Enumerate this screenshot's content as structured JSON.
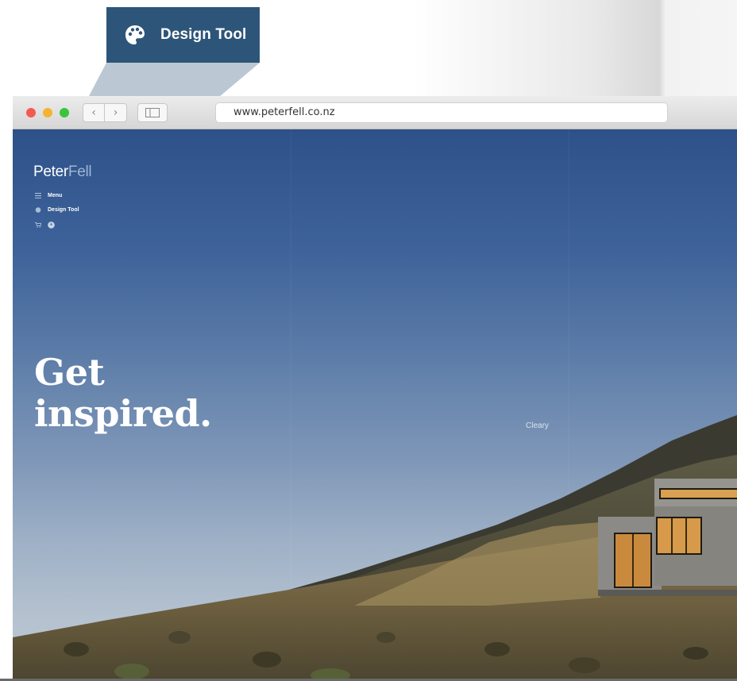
{
  "callout": {
    "icon": "palette-icon",
    "label": "Design Tool",
    "color": "#2d5579"
  },
  "browser": {
    "url": "www.peterfell.co.nz",
    "nav_back_glyph": "‹",
    "nav_forward_glyph": "›"
  },
  "site": {
    "logo_primary": "Peter",
    "logo_accent": "Fell",
    "nav": {
      "menu_label": "Menu",
      "design_tool_label": "Design Tool"
    },
    "hero_line1": "Get",
    "hero_line2": "inspired.",
    "caption": "Cleary"
  }
}
